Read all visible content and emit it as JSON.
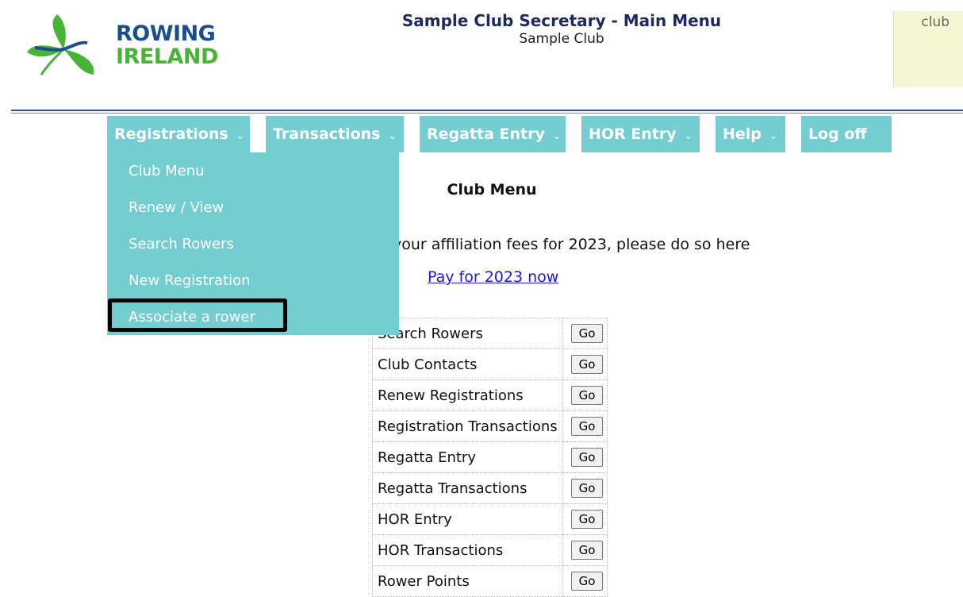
{
  "header": {
    "logo_line1": "ROWING",
    "logo_line2": "IRELAND",
    "page_title": "Sample Club Secretary - Main Menu",
    "club_name": "Sample Club",
    "corner_label": "club"
  },
  "colors": {
    "nav_bg": "#74cdd1",
    "title_color": "#1c2a5c",
    "logo_blue": "#1b4f8c",
    "logo_green": "#49b337",
    "link_color": "#1a1ae6",
    "corner_bg": "#f4f7d1"
  },
  "nav": {
    "items": [
      {
        "label": "Registrations",
        "has_dropdown": true,
        "icon": "chevron-down-icon"
      },
      {
        "label": "Transactions",
        "has_dropdown": true,
        "icon": "chevron-down-icon"
      },
      {
        "label": "Regatta Entry",
        "has_dropdown": true,
        "icon": "chevron-down-icon"
      },
      {
        "label": "HOR Entry",
        "has_dropdown": true,
        "icon": "chevron-down-icon"
      },
      {
        "label": "Help",
        "has_dropdown": true,
        "icon": "chevron-down-icon"
      },
      {
        "label": "Log off",
        "has_dropdown": false
      }
    ]
  },
  "dropdown": {
    "items": [
      "Club Menu",
      "Renew / View",
      "Search Rowers",
      "New Registration",
      "Associate a rower"
    ],
    "highlighted": "Associate a rower"
  },
  "main": {
    "section_title": "Club Menu",
    "info_text": "your affiliation fees for 2023, please do so here",
    "pay_link": "Pay for 2023 now",
    "go_label": "Go",
    "menu_rows": [
      "Search Rowers",
      "Club Contacts",
      "Renew Registrations",
      "Registration Transactions",
      "Regatta Entry",
      "Regatta Transactions",
      "HOR Entry",
      "HOR Transactions",
      "Rower Points"
    ]
  }
}
